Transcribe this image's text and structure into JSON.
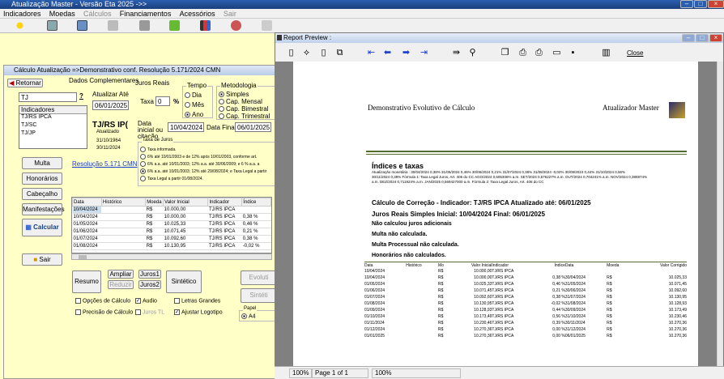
{
  "app": {
    "title": "Atualização Master  - Versão Eta 2025 ->>"
  },
  "menu": [
    "Indicadores",
    "Moedas",
    "Cálculos",
    "Financiamentos",
    "Acessórios",
    "Sair"
  ],
  "toolbar": {
    "icons": [
      "sun-icon",
      "gear-icon",
      "calculator-icon",
      "chart-icon",
      "folder-icon",
      "book-icon",
      "bar-chart-icon",
      "speaker-icon",
      "help-icon"
    ]
  },
  "calc": {
    "title": "Cálculo Atualização =>Demonstrativo conf. Resolução 5.171/2024 CMN",
    "retornar": "Retornar",
    "dados_complementares": "Dados Complementares",
    "search_value": "TJ",
    "indicators_header": "Indicadores",
    "indicators": [
      "TJ/RS IPCA",
      "TJ/SC",
      "TJ/JP"
    ],
    "atualizar_ate_label": "Atualizar Até",
    "atualizar_ate": "06/01/2025",
    "indicador_nome": "TJ/RS IP(",
    "atualizado": "Atualizado",
    "data1": "31/10/1964",
    "data2": "30/11/2024",
    "juros_reais": "Juros Reais",
    "taxa_label": "Taxa",
    "taxa_value": "0",
    "pct": "%",
    "tempo_label": "Tempo",
    "tempo": [
      "Dia",
      "Mês",
      "Ano"
    ],
    "metodologia_label": "Metodologia",
    "metodologia": [
      "Simples",
      "Cap. Mensal",
      "Cap. Bimestral",
      "Cap. Trimestral"
    ],
    "data_inicial_label": "Data inicial ou citação",
    "data_inicial": "10/04/2024",
    "data_final_label": "Data Final",
    "data_final": "06/01/2025",
    "taxa_juros_label": "Taxa de Juros",
    "taxa_juros_opts": [
      "Taxa informada.",
      "6% até 10/01/2003 e de 12% após 10/01/2003, conforme art.",
      "6% a.a. até 10/01/2003; 12% a.a. até 30/06/2009; e 6 % a.a. a",
      "6% a.a. até 10/01/2003; 12% até 29/08/2024; e Taxa Legal a partir",
      "Taxa Legal a partir 01/08/2024."
    ],
    "multa": "Multa",
    "honorarios": "Honorários",
    "cabecalho": "Cabeçalho",
    "manifestacoes": "Manifestações",
    "calcular": "Calcular",
    "sair": "Sair",
    "resolucao_link": "Resolução 5.171 CMN",
    "grid_headers": [
      "Data",
      "Histórico",
      "Moeda",
      "Valor Inicial",
      "Indicador",
      "Índice"
    ],
    "grid_rows": [
      [
        "10/04/2024",
        "",
        "R$",
        "10.000,00",
        "TJ/RS IPCA",
        ""
      ],
      [
        "10/04/2024",
        "",
        "R$",
        "10.000,00",
        "TJ/RS IPCA",
        "0,38 %"
      ],
      [
        "01/05/2024",
        "",
        "R$",
        "10.025,33",
        "TJ/RS IPCA",
        "0,46 %"
      ],
      [
        "01/06/2024",
        "",
        "R$",
        "10.071,45",
        "TJ/RS IPCA",
        "0,21 %"
      ],
      [
        "01/07/2024",
        "",
        "R$",
        "10.092,60",
        "TJ/RS IPCA",
        "0,38 %"
      ],
      [
        "01/08/2024",
        "",
        "R$",
        "10.130,95",
        "TJ/RS IPCA",
        "-0,02 %"
      ]
    ],
    "resumo": "Resumo",
    "ampliar": "Ampliar",
    "reduzir": "Reduzir",
    "juros1": "Juros1",
    "juros2": "Juros2",
    "sintetico": "Sintético",
    "evolutivo": "Evoluti",
    "sintetico2": "Sintéti",
    "opcoes_calculo": "Opções de Cálculo",
    "audio": "Audio",
    "letras_grandes": "Letras Grandes",
    "precisao_calculo": "Precisão de Cálculo",
    "juros_tl": "Juros TL",
    "ajustar_logotipo": "Ajustar Logotipo",
    "papel_label": "Papel",
    "papel_value": "A4"
  },
  "preview": {
    "title": "Report Preview :",
    "close": "Close",
    "report_title": "Demonstrativo Evolutivo de Cálculo",
    "report_brand": "Atualizador Master",
    "indices_taxas": "Índices e taxas",
    "indices_line1": "Atualização monetária : 30/04/2024 0,38%  31/05/2024 0,46%  30/06/2024 0,21%  31/07/2024 0,38%  31/08/2024 -0,02%  30/09/2024 0,44%  31/10/2024 0,56%",
    "indices_line2": "30/11/2024 0,39%  Fórmula 1: Taxa Legal Juros, Art. 406 do CC  AGO/2024 0,605306% a.m.  SET/2024 0,576227% a.m.  OUT/2024 0,704241% a.m.  NOV/2024 0,385974%",
    "indices_line3": "a.m.  DEZ/2024 0,711924% a.m.  JAN/2025 0,569427000 a.m.  Fórmula 2: Taxa Legal Juros, Art. 406 do CC",
    "calc_correcao": "Cálculo de Correção - Indicador: TJ/RS IPCA    Atualizado até: 06/01/2025",
    "juros_reais": "Juros Reais Simples Inicial: 10/04/2024 Final: 06/01/2025",
    "nao_juros": "Não calculou juros adicionais",
    "multa": "Multa não calculada.",
    "multa_proc": "Multa Processual não calculada.",
    "honorarios": "Honorários não calculados.",
    "table_headers": [
      "Data",
      "Histórico",
      "Mo",
      "Valor Inicial",
      "Indicador",
      "Índice",
      "Data",
      "Moeda",
      "Valor Corrigido"
    ],
    "table_rows": [
      [
        "10/04/2024",
        "",
        "R$",
        "10.000,00",
        "TJ/RS IPCA",
        "",
        "",
        "",
        ""
      ],
      [
        "10/04/2024",
        "",
        "R$",
        "10.000,00",
        "TJ/RS IPCA",
        "0,38 %",
        "30/04/2024",
        "R$",
        "10.025,33"
      ],
      [
        "01/05/2024",
        "",
        "R$",
        "10.025,33",
        "TJ/RS IPCA",
        "0,46 %",
        "31/05/2024",
        "R$",
        "10.071,45"
      ],
      [
        "01/06/2024",
        "",
        "R$",
        "10.071,45",
        "TJ/RS IPCA",
        "0,21 %",
        "30/06/2024",
        "R$",
        "10.092,60"
      ],
      [
        "01/07/2024",
        "",
        "R$",
        "10.092,60",
        "TJ/RS IPCA",
        "0,38 %",
        "31/07/2024",
        "R$",
        "10.130,95"
      ],
      [
        "01/08/2024",
        "",
        "R$",
        "10.130,95",
        "TJ/RS IPCA",
        "-0,02 %",
        "31/08/2024",
        "R$",
        "10.128,93"
      ],
      [
        "01/09/2024",
        "",
        "R$",
        "10.128,93",
        "TJ/RS IPCA",
        "0,44 %",
        "30/09/2024",
        "R$",
        "10.173,49"
      ],
      [
        "01/10/2024",
        "",
        "R$",
        "10.173,49",
        "TJ/RS IPCA",
        "0,56 %",
        "31/10/2024",
        "R$",
        "10.230,46"
      ],
      [
        "01/11/2024",
        "",
        "R$",
        "10.230,46",
        "TJ/RS IPCA",
        "0,39 %",
        "30/11/2024",
        "R$",
        "10.270,36"
      ],
      [
        "01/12/2024",
        "",
        "R$",
        "10.270,36",
        "TJ/RS IPCA",
        "0,00 %",
        "31/12/2024",
        "R$",
        "10.270,36"
      ],
      [
        "01/01/2025",
        "",
        "R$",
        "10.270,36",
        "TJ/RS IPCA",
        "0,00 %",
        "06/01/2025",
        "R$",
        "10.270,36"
      ]
    ],
    "status_zoom": "100%",
    "status_page": "Page 1 of 1",
    "status_zoom2": "100%"
  },
  "colors": {
    "accent": "#1c3f7c",
    "panel": "#ffffc8",
    "report_rule": "#556b2f"
  }
}
